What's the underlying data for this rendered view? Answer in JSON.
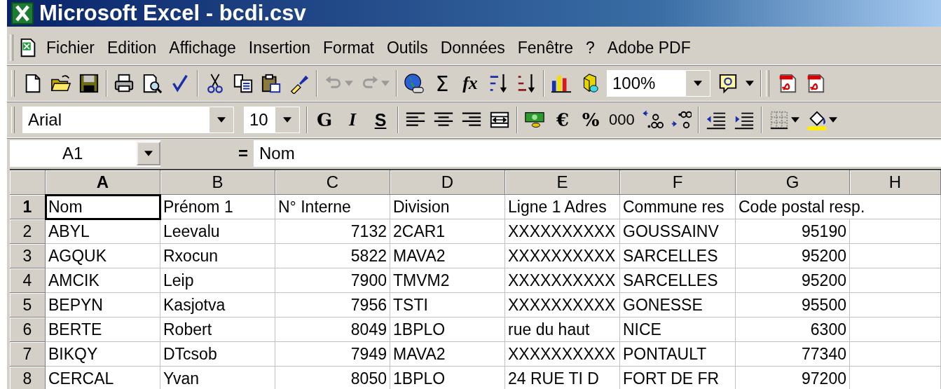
{
  "window": {
    "title": "Microsoft Excel - bcdi.csv"
  },
  "menu": [
    "Fichier",
    "Edition",
    "Affichage",
    "Insertion",
    "Format",
    "Outils",
    "Données",
    "Fenêtre",
    "?",
    "Adobe PDF"
  ],
  "standard_toolbar": {
    "undo": {
      "disabled": true
    },
    "redo": {
      "disabled": true
    },
    "autosum": "Σ",
    "function": "fx",
    "zoom": "100%"
  },
  "formatting_toolbar": {
    "font": "Arial",
    "size": "10",
    "bold": "G",
    "italic": "I",
    "underline": "S",
    "euro": "€",
    "percent": "%",
    "thousands": "000"
  },
  "formula_bar": {
    "name_box": "A1",
    "equals": "=",
    "content": "Nom"
  },
  "sheet": {
    "columns": [
      "A",
      "B",
      "C",
      "D",
      "E",
      "F",
      "G",
      "H"
    ],
    "rows": [
      {
        "header": "1",
        "cells": [
          {
            "text": "Nom",
            "kind": "text",
            "selected": true
          },
          {
            "text": "Prénom 1",
            "kind": "text",
            "selected": false
          },
          {
            "text": "N° Interne",
            "kind": "text",
            "selected": false
          },
          {
            "text": "Division",
            "kind": "text",
            "selected": false
          },
          {
            "text": "Ligne 1 Adres",
            "kind": "text",
            "selected": false
          },
          {
            "text": "Commune res",
            "kind": "text",
            "selected": false
          },
          {
            "text": "Code postal resp.",
            "kind": "text",
            "selected": false
          }
        ]
      },
      {
        "header": "2",
        "cells": [
          {
            "text": "ABYL",
            "kind": "text",
            "selected": false
          },
          {
            "text": "Leevalu",
            "kind": "text",
            "selected": false
          },
          {
            "text": "7132",
            "kind": "number",
            "selected": false
          },
          {
            "text": "2CAR1",
            "kind": "text",
            "selected": false
          },
          {
            "text": "XXXXXXXXXX",
            "kind": "text",
            "selected": false
          },
          {
            "text": "GOUSSAINV",
            "kind": "text",
            "selected": false
          },
          {
            "text": "95190",
            "kind": "number",
            "selected": false
          }
        ]
      },
      {
        "header": "3",
        "cells": [
          {
            "text": "AGQUK",
            "kind": "text",
            "selected": false
          },
          {
            "text": "Rxocun",
            "kind": "text",
            "selected": false
          },
          {
            "text": "5822",
            "kind": "number",
            "selected": false
          },
          {
            "text": "MAVA2",
            "kind": "text",
            "selected": false
          },
          {
            "text": "XXXXXXXXXX",
            "kind": "text",
            "selected": false
          },
          {
            "text": "SARCELLES",
            "kind": "text",
            "selected": false
          },
          {
            "text": "95200",
            "kind": "number",
            "selected": false
          }
        ]
      },
      {
        "header": "4",
        "cells": [
          {
            "text": "AMCIK",
            "kind": "text",
            "selected": false
          },
          {
            "text": "Leip",
            "kind": "text",
            "selected": false
          },
          {
            "text": "7900",
            "kind": "number",
            "selected": false
          },
          {
            "text": "TMVM2",
            "kind": "text",
            "selected": false
          },
          {
            "text": "XXXXXXXXXX",
            "kind": "text",
            "selected": false
          },
          {
            "text": "SARCELLES",
            "kind": "text",
            "selected": false
          },
          {
            "text": "95200",
            "kind": "number",
            "selected": false
          }
        ]
      },
      {
        "header": "5",
        "cells": [
          {
            "text": "BEPYN",
            "kind": "text",
            "selected": false
          },
          {
            "text": "Kasjotva",
            "kind": "text",
            "selected": false
          },
          {
            "text": "7956",
            "kind": "number",
            "selected": false
          },
          {
            "text": "TSTI",
            "kind": "text",
            "selected": false
          },
          {
            "text": "XXXXXXXXXX",
            "kind": "text",
            "selected": false
          },
          {
            "text": "GONESSE",
            "kind": "text",
            "selected": false
          },
          {
            "text": "95500",
            "kind": "number",
            "selected": false
          }
        ]
      },
      {
        "header": "6",
        "cells": [
          {
            "text": "BERTE",
            "kind": "text",
            "selected": false
          },
          {
            "text": "Robert",
            "kind": "text",
            "selected": false
          },
          {
            "text": "8049",
            "kind": "number",
            "selected": false
          },
          {
            "text": "1BPLO",
            "kind": "text",
            "selected": false
          },
          {
            "text": "rue du haut",
            "kind": "text",
            "selected": false
          },
          {
            "text": "NICE",
            "kind": "text",
            "selected": false
          },
          {
            "text": "6300",
            "kind": "number",
            "selected": false
          }
        ]
      },
      {
        "header": "7",
        "cells": [
          {
            "text": "BIKQY",
            "kind": "text",
            "selected": false
          },
          {
            "text": "DTcsob",
            "kind": "text",
            "selected": false
          },
          {
            "text": "7949",
            "kind": "number",
            "selected": false
          },
          {
            "text": "MAVA2",
            "kind": "text",
            "selected": false
          },
          {
            "text": "XXXXXXXXXX",
            "kind": "text",
            "selected": false
          },
          {
            "text": "PONTAULT",
            "kind": "text",
            "selected": false
          },
          {
            "text": "77340",
            "kind": "number",
            "selected": false
          }
        ]
      },
      {
        "header": "8",
        "cells": [
          {
            "text": "CERCAL",
            "kind": "text",
            "selected": false
          },
          {
            "text": "Yvan",
            "kind": "text",
            "selected": false
          },
          {
            "text": "8050",
            "kind": "number",
            "selected": false
          },
          {
            "text": "1BPLO",
            "kind": "text",
            "selected": false
          },
          {
            "text": "24 RUE TI D",
            "kind": "text",
            "selected": false
          },
          {
            "text": "FORT DE FR",
            "kind": "text",
            "selected": false
          },
          {
            "text": "97200",
            "kind": "number",
            "selected": false
          }
        ]
      }
    ]
  }
}
